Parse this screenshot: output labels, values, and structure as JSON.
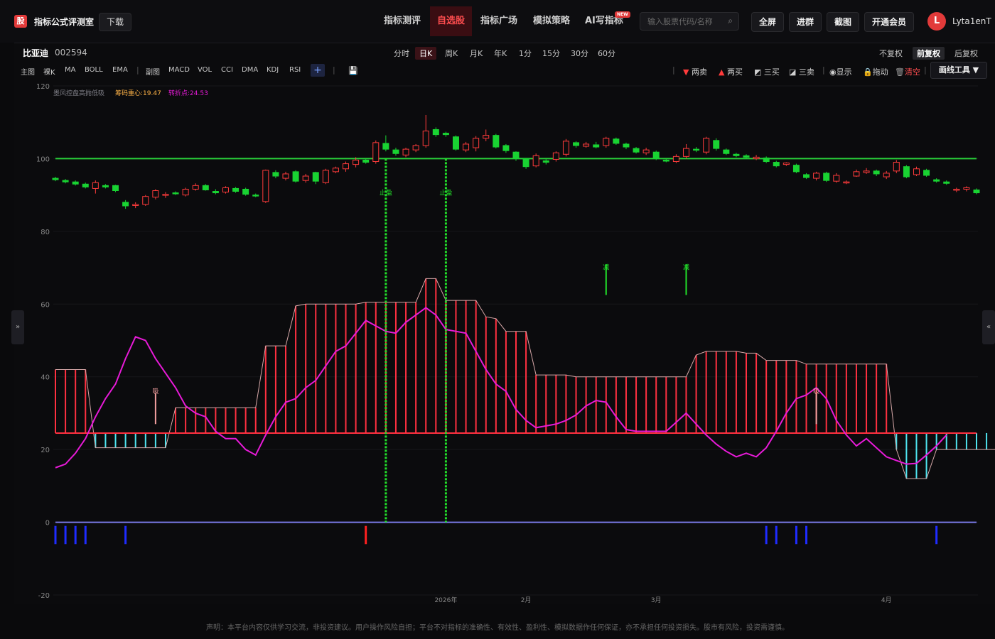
{
  "header": {
    "logo_char": "股",
    "app_title": "指标公式评测室",
    "download_label": "下载",
    "nav": [
      "指标测评",
      "自选股",
      "指标广场",
      "模拟策略",
      "AI写指标"
    ],
    "new_badge": "NEW",
    "search_placeholder": "输入股票代码/名称",
    "buttons": [
      "全屏",
      "进群",
      "截图",
      "开通会员"
    ],
    "avatar_letter": "L",
    "username": "Lyta1enT"
  },
  "stock": {
    "name": "比亚迪",
    "code": "002594"
  },
  "periods": [
    "分时",
    "日K",
    "周K",
    "月K",
    "年K",
    "1分",
    "15分",
    "30分",
    "60分"
  ],
  "active_period": "日K",
  "adjust": [
    "不复权",
    "前复权",
    "后复权"
  ],
  "active_adjust": "前复权",
  "main_indicators": [
    "主图",
    "裸K",
    "MA",
    "BOLL",
    "EMA"
  ],
  "sub_indicators": [
    "副图",
    "MACD",
    "VOL",
    "CCI",
    "DMA",
    "KDJ",
    "RSI"
  ],
  "tools": [
    "两卖",
    "两买",
    "三买",
    "三卖",
    "显示",
    "拖动",
    "清空"
  ],
  "draw_tool_label": "画线工具 ▼",
  "side_left": "»",
  "side_right": "«",
  "disclaimer": "声明：本平台内容仅供学习交流，非投资建议。用户操作风险自担；平台不对指标的准确性、有效性、盈利性、模拟数据作任何保证，亦不承担任何投资损失。股市有风险，投资需谨慎。",
  "chart_data": {
    "type": "candlestick",
    "legend": {
      "name": "墨风控盘高抛低吸",
      "item1": "筹码重心:19.47",
      "item2": "转折点:24.53"
    },
    "y_ticks": [
      120,
      100,
      80,
      60,
      40,
      20,
      0,
      -20
    ],
    "ylim": [
      -20,
      120
    ],
    "x_labels": [
      {
        "i": 39,
        "label": "2026年"
      },
      {
        "i": 47,
        "label": "2月"
      },
      {
        "i": 60,
        "label": "3月"
      },
      {
        "i": 83,
        "label": "4月"
      }
    ],
    "ref_line": 100,
    "zero_line": 0,
    "candles": [
      [
        94.6,
        94.2,
        95,
        93.8
      ],
      [
        94,
        93.6,
        94.4,
        93.2
      ],
      [
        93.6,
        93,
        94,
        92.6
      ],
      [
        93,
        92.2,
        93.4,
        91.8
      ],
      [
        91.8,
        93.4,
        94,
        90.4
      ],
      [
        92.6,
        92.2,
        93,
        91.8
      ],
      [
        92.6,
        91.2,
        92.8,
        90.8
      ],
      [
        88,
        87,
        88.6,
        86.2
      ],
      [
        87.2,
        87.4,
        88,
        86.4
      ],
      [
        87.4,
        89.6,
        90,
        87
      ],
      [
        89.4,
        91.2,
        91.6,
        88.8
      ],
      [
        90,
        90.2,
        90.8,
        89.2
      ],
      [
        90.6,
        90.4,
        91,
        90
      ],
      [
        90,
        91.6,
        92,
        89.6
      ],
      [
        91.6,
        92.6,
        93.2,
        91.2
      ],
      [
        92.6,
        91.4,
        93,
        91.2
      ],
      [
        91,
        90.6,
        91.6,
        90.2
      ],
      [
        90.8,
        92,
        92.4,
        90.4
      ],
      [
        91.8,
        91,
        92.2,
        90.6
      ],
      [
        91.6,
        90.2,
        92,
        89.8
      ],
      [
        90,
        89.8,
        90.4,
        89.4
      ],
      [
        88.2,
        96.8,
        97,
        87.8
      ],
      [
        96.2,
        95.2,
        96.8,
        94.6
      ],
      [
        94.6,
        95.8,
        96.4,
        94
      ],
      [
        96.4,
        93.8,
        96.8,
        93.4
      ],
      [
        94,
        95.2,
        95.8,
        93.4
      ],
      [
        96.2,
        93.8,
        96.4,
        93
      ],
      [
        93.4,
        96.8,
        97.2,
        93
      ],
      [
        96.4,
        97.4,
        97.8,
        96
      ],
      [
        97.2,
        98.6,
        99.2,
        96.4
      ],
      [
        98.4,
        99.6,
        100.4,
        97.6
      ],
      [
        99.6,
        99,
        100,
        98.6
      ],
      [
        99.2,
        104.4,
        105,
        98.6
      ],
      [
        104.2,
        102.6,
        106.4,
        102
      ],
      [
        102.4,
        101.4,
        103,
        100.8
      ],
      [
        101,
        102.6,
        103,
        100.4
      ],
      [
        102.4,
        103.6,
        104,
        101.8
      ],
      [
        103.6,
        107.6,
        112,
        103
      ],
      [
        108,
        106.6,
        108.6,
        106
      ],
      [
        107,
        106.6,
        107.4,
        106
      ],
      [
        106,
        102.6,
        106.4,
        102.2
      ],
      [
        102.4,
        104,
        104.6,
        101.8
      ],
      [
        103,
        105.6,
        106.2,
        102
      ],
      [
        105.6,
        106.4,
        108,
        104.8
      ],
      [
        106.4,
        103.2,
        106.8,
        102.8
      ],
      [
        103.6,
        102.2,
        104,
        101.6
      ],
      [
        101.8,
        100,
        102,
        99.4
      ],
      [
        100,
        97.8,
        100.2,
        97.2
      ],
      [
        98,
        100.8,
        101.4,
        97.6
      ],
      [
        99.4,
        99,
        100,
        98.4
      ],
      [
        99.8,
        101.6,
        102,
        99.2
      ],
      [
        101.2,
        104.8,
        105.4,
        100.6
      ],
      [
        104.4,
        103.6,
        104.8,
        103
      ],
      [
        103.4,
        104,
        104.6,
        103
      ],
      [
        103.8,
        103.2,
        104.6,
        102.8
      ],
      [
        103.6,
        105.6,
        106,
        103
      ],
      [
        105.4,
        104.2,
        105.8,
        103.8
      ],
      [
        104,
        103.2,
        104.4,
        102.6
      ],
      [
        102.8,
        101.8,
        103.2,
        101.4
      ],
      [
        101.6,
        102.4,
        103,
        101
      ],
      [
        101.8,
        100,
        102.2,
        99.6
      ],
      [
        99.6,
        99.4,
        100,
        99
      ],
      [
        99.2,
        100.6,
        101.2,
        98.8
      ],
      [
        100.6,
        102.8,
        104,
        100
      ],
      [
        102.6,
        102.4,
        103.2,
        101.8
      ],
      [
        101.8,
        105.6,
        106,
        101.2
      ],
      [
        105,
        102.8,
        105.6,
        102.2
      ],
      [
        102.4,
        101.4,
        102.8,
        101
      ],
      [
        101.2,
        100.8,
        101.6,
        100.4
      ],
      [
        100.8,
        100.4,
        101.2,
        100
      ],
      [
        100,
        100.4,
        101,
        99.6
      ],
      [
        100.2,
        99.2,
        100.6,
        98.8
      ],
      [
        99,
        98,
        99.4,
        97.6
      ],
      [
        98.4,
        98.8,
        99,
        98
      ],
      [
        98.2,
        96.4,
        98.6,
        96
      ],
      [
        95.6,
        94.8,
        96,
        94.4
      ],
      [
        94.6,
        96,
        96.4,
        94
      ],
      [
        96,
        94,
        96.4,
        93.6
      ],
      [
        93.8,
        95.4,
        96,
        93.4
      ],
      [
        93.6,
        93.6,
        94,
        93
      ],
      [
        95.2,
        96.4,
        97,
        95
      ],
      [
        96.2,
        96.6,
        97.4,
        95.8
      ],
      [
        96.6,
        95.8,
        97,
        95.2
      ],
      [
        95,
        96,
        96.6,
        94.4
      ],
      [
        96.6,
        99,
        99.6,
        96
      ],
      [
        97.8,
        95,
        98.2,
        94.6
      ],
      [
        95.6,
        97.2,
        97.8,
        95.2
      ],
      [
        96.8,
        95.4,
        97.2,
        95
      ],
      [
        94.2,
        93.8,
        94.6,
        93.4
      ],
      [
        93.6,
        93.2,
        94,
        92.8
      ],
      [
        91.4,
        91.6,
        92,
        90.8
      ],
      [
        91.6,
        92,
        92.4,
        91
      ],
      [
        91.4,
        90.6,
        91.8,
        90.2
      ]
    ],
    "zone_values": [
      42,
      42,
      42,
      42,
      20.5,
      20.5,
      20.5,
      20.5,
      20.5,
      20.5,
      20.5,
      20.5,
      31.5,
      31.5,
      31.5,
      31.5,
      31.5,
      31.5,
      31.5,
      31.5,
      31.5,
      48.5,
      48.5,
      48.5,
      59.5,
      60,
      60,
      60,
      60,
      60,
      60,
      60.5,
      60.5,
      60.5,
      60.5,
      60.5,
      60.5,
      67,
      67,
      61,
      61,
      61,
      61,
      56.5,
      56,
      52.5,
      52.5,
      52.5,
      40.5,
      40.5,
      40.5,
      40.5,
      40,
      40,
      40,
      40,
      40,
      40,
      40,
      40,
      40,
      40,
      40,
      40,
      46,
      47,
      47,
      47,
      47,
      46.5,
      46.5,
      44.5,
      44.5,
      44.5,
      44.5,
      43.5,
      43.5,
      43.5,
      43.5,
      43.5,
      43.5,
      43.5,
      43.5,
      43.5,
      20,
      12,
      12,
      12,
      20,
      20,
      20,
      20,
      20,
      20,
      20
    ],
    "zone_baseline": 24.53,
    "pink_line": [
      15,
      16,
      19,
      23,
      29,
      34,
      38,
      45,
      51,
      50,
      45,
      41,
      37,
      32,
      30,
      29,
      25,
      23,
      23,
      20,
      18.5,
      24,
      29,
      33,
      34,
      37,
      39,
      43,
      47,
      48.5,
      52,
      55.5,
      54,
      52.5,
      52,
      55,
      57,
      59,
      57,
      53,
      52.5,
      52,
      47,
      42,
      38,
      36,
      31,
      28,
      26,
      26.5,
      27,
      28,
      29.5,
      32,
      33.5,
      33,
      29,
      25.5,
      25,
      25,
      25,
      25,
      27.5,
      30,
      27,
      24,
      21.5,
      19.5,
      18,
      19,
      18,
      20.5,
      25,
      30,
      34,
      35,
      37,
      34,
      28,
      24,
      21,
      23,
      20.5,
      18,
      17,
      16,
      16.2,
      18.5,
      21,
      24
    ],
    "blue_ticks": [
      0,
      1,
      2,
      3,
      7,
      71,
      72,
      74,
      75,
      88
    ],
    "red_tick": 31,
    "signals": [
      {
        "type": "buy-marker",
        "label": "止盈",
        "i": 33
      },
      {
        "type": "buy-marker",
        "label": "止盈",
        "i": 39
      },
      {
        "type": "arrow",
        "label": "减",
        "i": 55
      },
      {
        "type": "arrow",
        "label": "减",
        "i": 63
      },
      {
        "type": "marker",
        "label": "吸",
        "i": 10
      },
      {
        "type": "marker",
        "label": "吸",
        "i": 76
      }
    ],
    "colors": {
      "up": "#ff3b3b",
      "down": "#19d332",
      "ref": "#29d03a",
      "zone_up": "#ff3040",
      "zone_down": "#4fe4ef",
      "pink": "#e81ad8",
      "zero": "#7a7ae8",
      "blue_tick": "#1f2cff"
    }
  }
}
